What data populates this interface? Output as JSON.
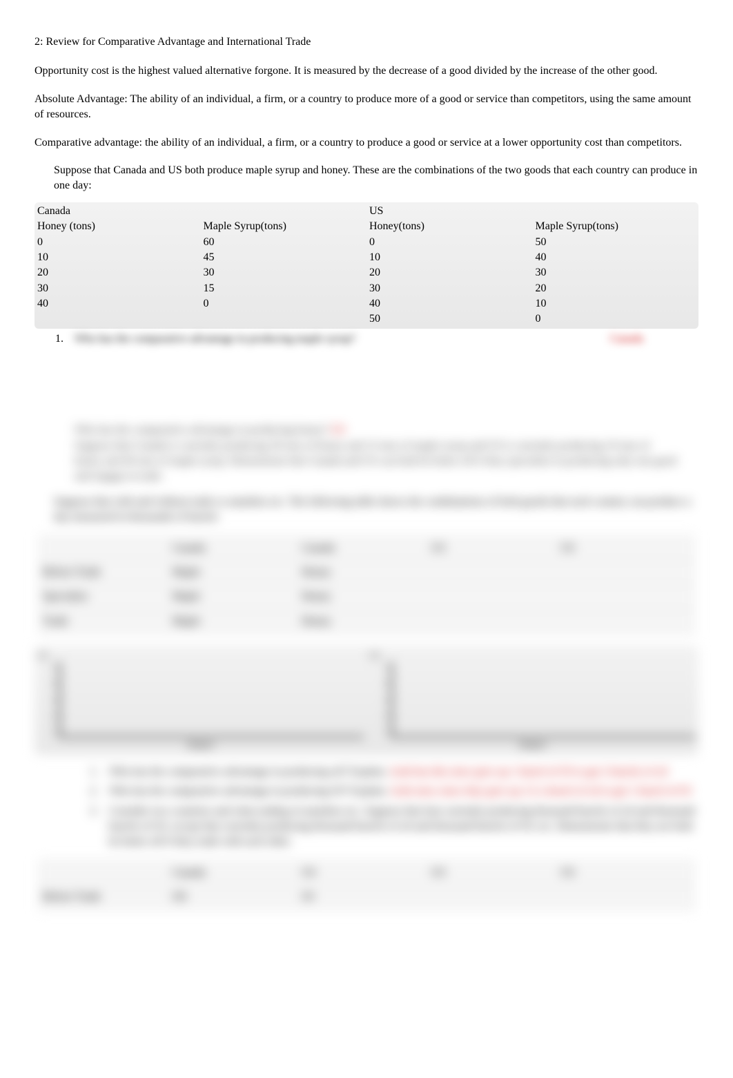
{
  "title": "2: Review for Comparative Advantage and International Trade",
  "para1": "Opportunity cost is the highest valued alternative forgone. It is measured by the decrease of a good divided by the increase of the other good.",
  "para2": "Absolute Advantage: The ability of an individual, a firm, or a country to produce more of a good or service than competitors, using the same amount of resources.",
  "para3": "Comparative advantage: the ability of an individual, a firm, or a country to produce a good or service at a lower opportunity cost than competitors.",
  "bullet_marker": "",
  "bullet1": "Suppose that Canada and US both produce maple syrup and honey. These are the combinations of the two goods that each country can produce in one day:",
  "table": {
    "left": {
      "country": "Canada",
      "h1": "Honey (tons)",
      "h2": "Maple Syrup(tons)",
      "rows": [
        {
          "a": "0",
          "b": "60"
        },
        {
          "a": "10",
          "b": "45"
        },
        {
          "a": "20",
          "b": "30"
        },
        {
          "a": "30",
          "b": "15"
        },
        {
          "a": "40",
          "b": "0"
        },
        {
          "a": "",
          "b": ""
        }
      ]
    },
    "right": {
      "country": "US",
      "h1": "Honey(tons)",
      "h2": "Maple Syrup(tons)",
      "rows": [
        {
          "a": "0",
          "b": "50"
        },
        {
          "a": "10",
          "b": "40"
        },
        {
          "a": "20",
          "b": "30"
        },
        {
          "a": "30",
          "b": "20"
        },
        {
          "a": "40",
          "b": "10"
        },
        {
          "a": "50",
          "b": "0"
        }
      ]
    }
  },
  "q1_num": "1.",
  "q1_text": "Who has the comparative advantage in producing maple syrup?",
  "q1_answer": "Canada",
  "hidden": {
    "q2_text": "Who has the comparative advantage in producing honey?",
    "q2_answer": "US",
    "para_a": "Suppose that Canada is currently producing 30 tons of honey and 15 tons of maple syrup and US is currently producing 10 tons of honey and 40 tons of maple syrup. Demonstrate that Canada and US can both be better off if they specialize in producing only one good and engage in trade.",
    "bullet2": "Suppose that with and without trade or autarkies etc. The following table shows the combinations of both goods that each country can produce a day measured in thousands of barrels",
    "table2": {
      "headers": [
        "",
        "Canada",
        "Canada",
        "US",
        "US"
      ],
      "rows": [
        {
          "label": "Before Trade",
          "c1": "Maple",
          "c2": "Honey",
          "c3": "",
          "c4": ""
        },
        {
          "label": "Specialize",
          "c1": "Maple",
          "c2": "Honey",
          "c3": "",
          "c4": ""
        },
        {
          "label": "Trade",
          "c1": "Maple",
          "c2": "Honey",
          "c3": "",
          "c4": ""
        }
      ]
    },
    "chart": {
      "left_label": "US",
      "right_label": "US",
      "xlabel_left": "(Maple)",
      "xlabel_right": "(Maple)"
    },
    "q_list": [
      {
        "num": "1.",
        "text": "Who has the comparative advantage in producing oil? Explain.",
        "ans": "Arab has this since give up 1 barrel of OJ to get 2 barrels of oil"
      },
      {
        "num": "2.",
        "text": "Who has the comparative advantage in producing OJ? Explain.",
        "ans": "Arab since since they give up 1/2 a barrel of oil to get 1 barrel of OJ"
      },
      {
        "num": "3.",
        "text": "Consider two countries and what trading of autarkies etc. Suppose that Iran currently producing  thousand barrels of oil and  thousand barrels of OJ, except that currently producing  thousand barrels of oil and  thousand barrels of OJ, etc. Demonstrate that they are both be better off if they trade with each other."
      }
    ],
    "table3": {
      "headers": [
        "",
        "Canada",
        "US",
        "US",
        "US"
      ],
      "rows": [
        {
          "label": "Before Trade",
          "c1": "Oil",
          "c2": "OJ",
          "c3": "",
          "c4": ""
        }
      ]
    }
  }
}
